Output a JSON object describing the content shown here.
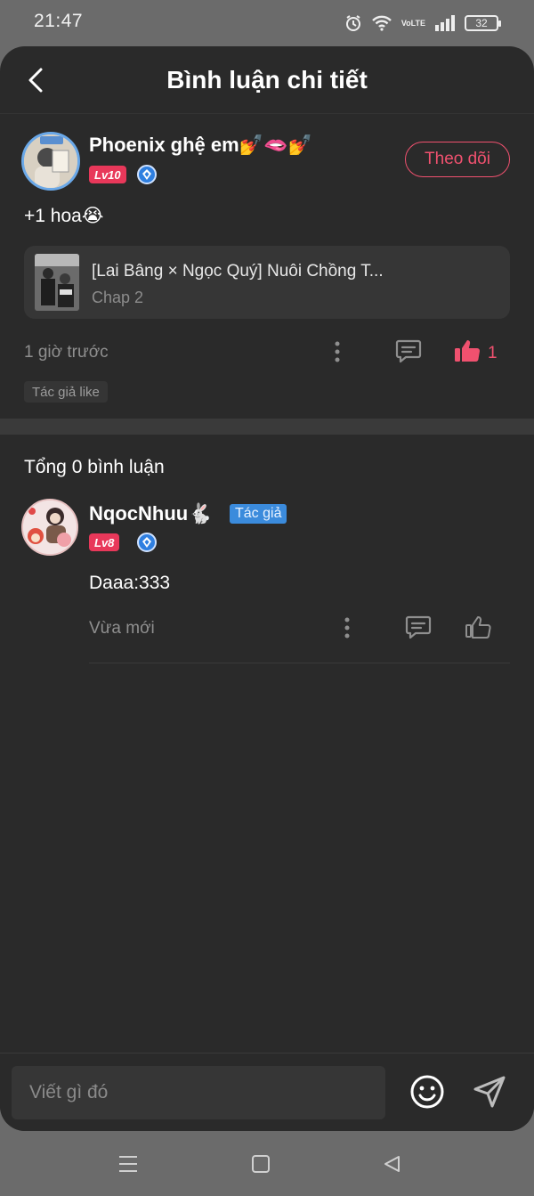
{
  "status_bar": {
    "time": "21:47",
    "battery": "32",
    "network_label_top": "Vo",
    "network_label_bottom": "LTE",
    "icons": [
      "alarm-icon",
      "wifi-icon",
      "volte-icon",
      "signal-icon",
      "battery-icon"
    ]
  },
  "header": {
    "title": "Bình luận chi tiết",
    "back_icon": "chevron-left-icon"
  },
  "main_comment": {
    "username": "Phoenix ghệ em💅🫦💅",
    "level": "Lv10",
    "follow_label": "Theo dõi",
    "text": "+1 hoa😭",
    "chapter_card": {
      "title": "[Lai Bâng × Ngọc Quý] Nuôi Chồng T...",
      "subtitle": "Chap 2"
    },
    "time": "1 giờ trước",
    "like_count": "1",
    "tag": "Tác giả like",
    "liked": true
  },
  "replies": {
    "heading": "Tổng 0 bình luận",
    "items": [
      {
        "username": "NqocNhuu🐇",
        "author_tag": "Tác giả",
        "level": "Lv8",
        "text": "Daaa:333",
        "time": "Vừa mới",
        "liked": false
      }
    ]
  },
  "input_bar": {
    "placeholder": "Viết gì đó"
  },
  "colors": {
    "accent": "#f0516f",
    "background": "#2a2a2a",
    "author_tag": "#3b8bdc",
    "level_badge": "#e8385a"
  }
}
